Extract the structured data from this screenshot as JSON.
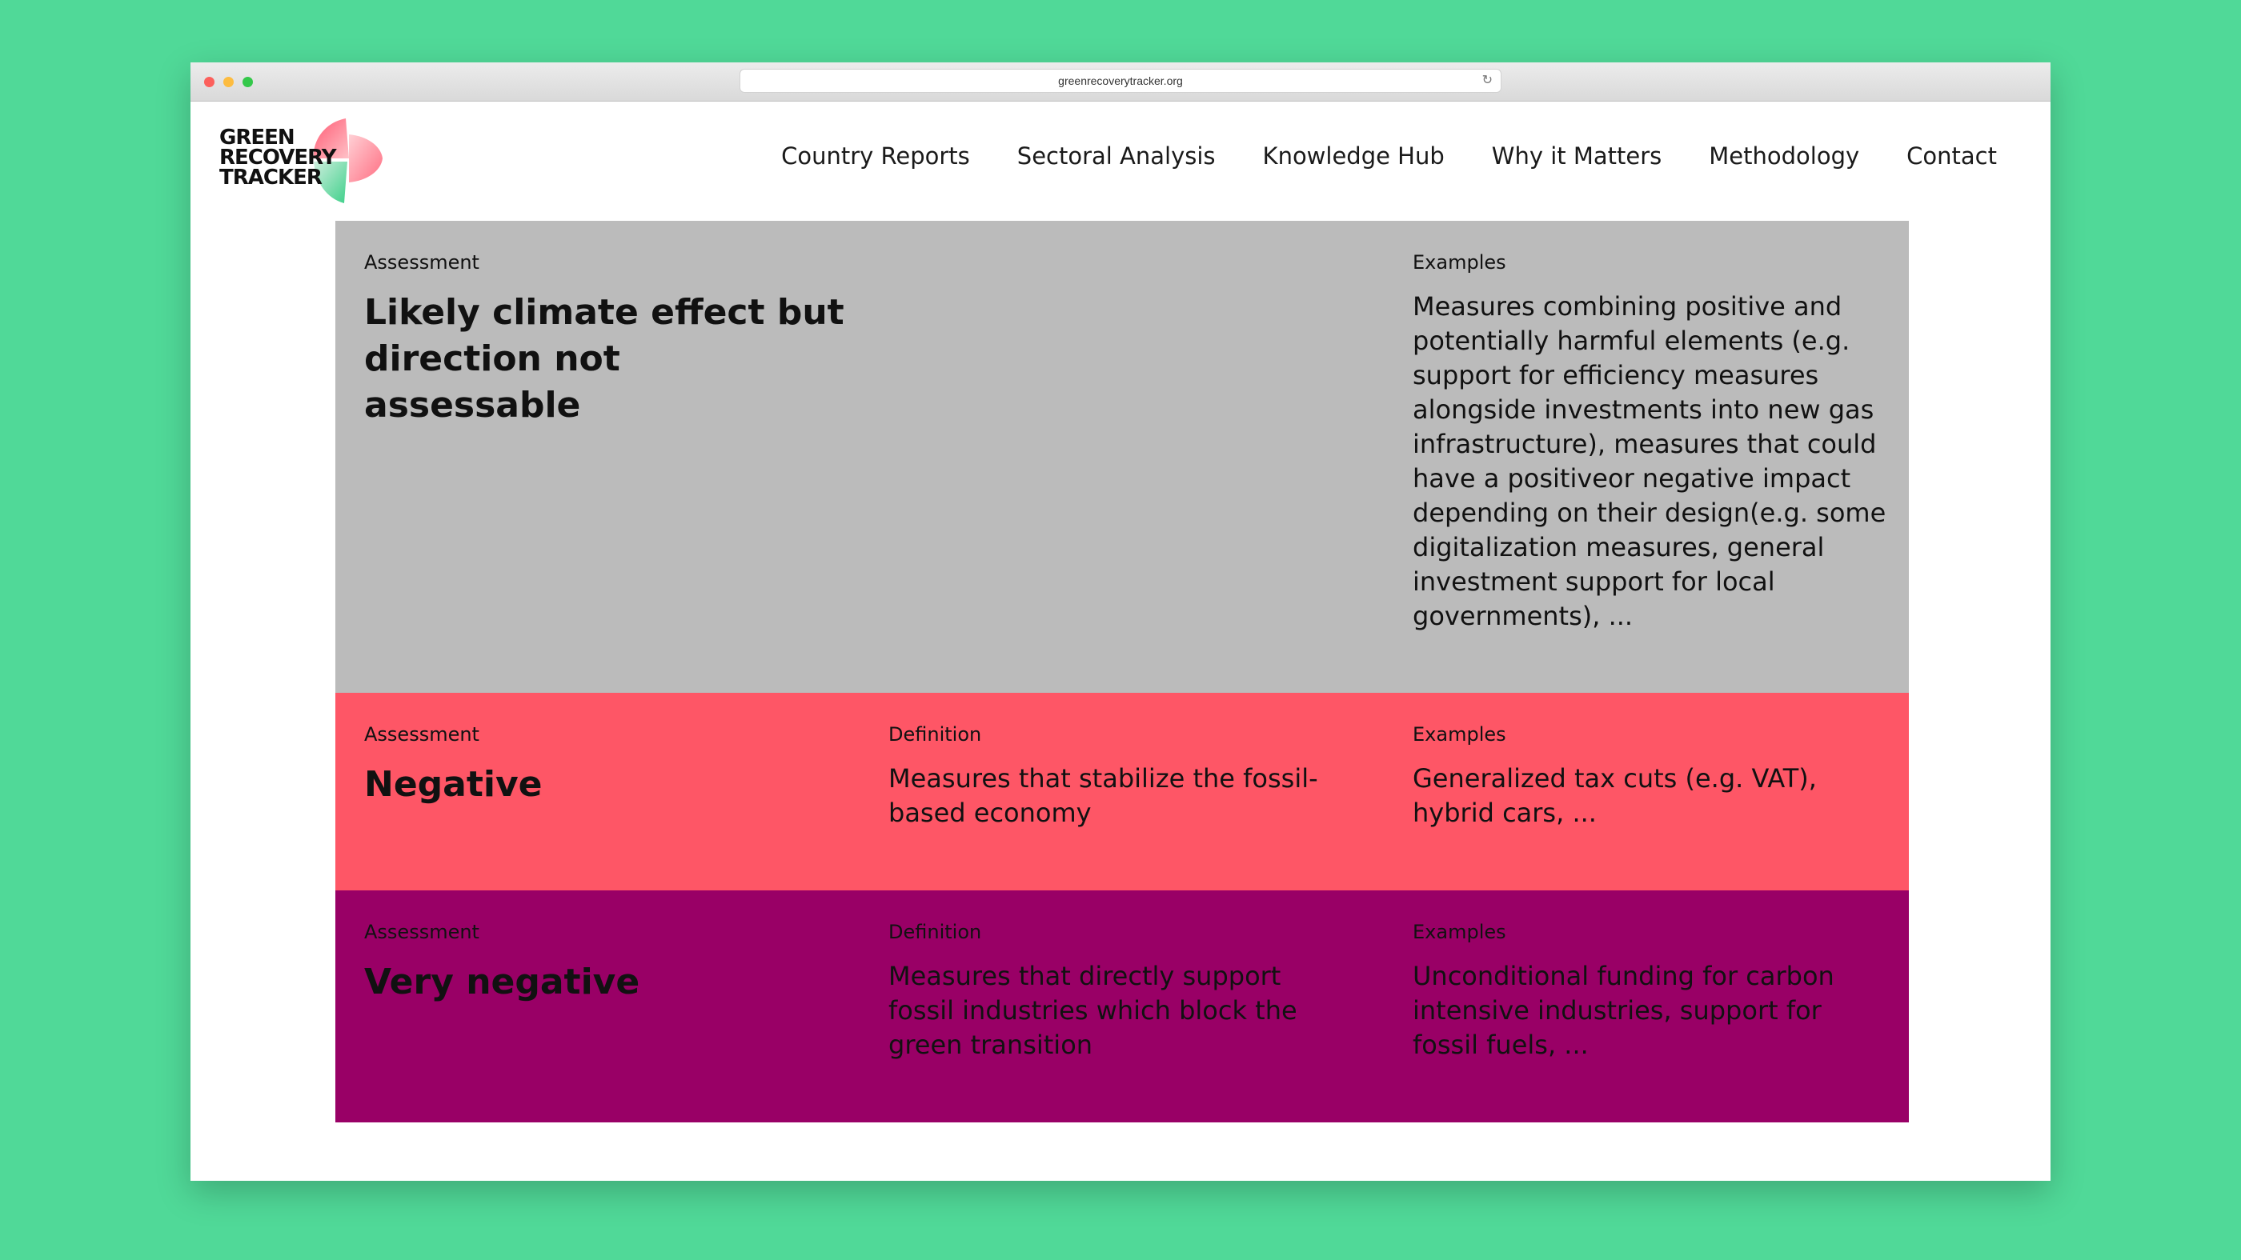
{
  "browser": {
    "url": "greenrecoverytracker.org",
    "reload_icon": "reload-icon"
  },
  "logo": {
    "lines": [
      "GREEN",
      "RECOVERY",
      "TRACKER"
    ]
  },
  "nav": {
    "items": [
      "Country Reports",
      "Sectoral Analysis",
      "Knowledge Hub",
      "Why it Matters",
      "Methodology",
      "Contact"
    ]
  },
  "colors": {
    "background": "#50d998",
    "gray_row": "#bbbbbb",
    "negative_row": "#fe5666",
    "very_negative_row": "#990066"
  },
  "rows": [
    {
      "assessment_label": "Assessment",
      "assessment": "Likely climate effect but direction not assessable",
      "definition_label": "",
      "definition": "",
      "examples_label": "Examples",
      "examples": "Measures combining positive and potentially harmful elements (e.g. support for efficiency measures alongside investments into new gas infrastructure), measures that could have a positiveor negative impact depending on their design(e.g. some digitalization measures, general investment support for local governments), ..."
    },
    {
      "assessment_label": "Assessment",
      "assessment": "Negative",
      "definition_label": "Definition",
      "definition": "Measures that stabilize the fossil-based economy",
      "examples_label": "Examples",
      "examples": "Generalized tax cuts (e.g. VAT), hybrid cars, ..."
    },
    {
      "assessment_label": "Assessment",
      "assessment": "Very negative",
      "definition_label": "Definition",
      "definition": "Measures that directly support fossil industries which block the green transition",
      "examples_label": "Examples",
      "examples": "Unconditional funding for carbon intensive industries, support for fossil fuels, ..."
    }
  ]
}
